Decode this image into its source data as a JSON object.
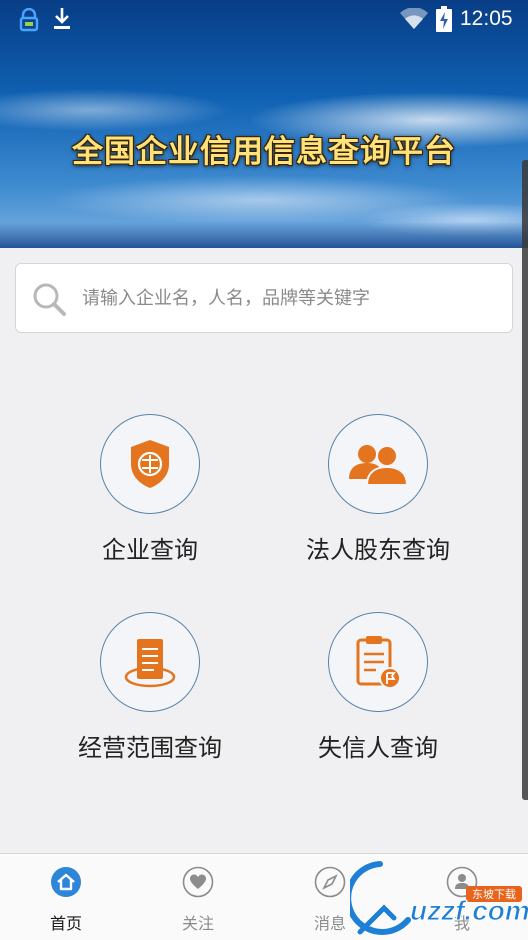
{
  "status_bar": {
    "time": "12:05",
    "icons": [
      "lock-icon",
      "download-icon",
      "wifi-icon",
      "battery-charging-icon"
    ]
  },
  "banner": {
    "title": "全国企业信用信息查询平台"
  },
  "search": {
    "placeholder": "请输入企业名，人名，品牌等关键字",
    "value": "",
    "icon": "search-icon"
  },
  "grid": [
    {
      "label": "企业查询",
      "icon": "shield-badge-icon"
    },
    {
      "label": "法人股东查询",
      "icon": "people-icon"
    },
    {
      "label": "经营范围查询",
      "icon": "document-stack-icon"
    },
    {
      "label": "失信人查询",
      "icon": "clipboard-flag-icon"
    }
  ],
  "bottom_nav": [
    {
      "label": "首页",
      "icon": "home-icon",
      "active": true
    },
    {
      "label": "关注",
      "icon": "heart-icon",
      "active": false
    },
    {
      "label": "消息",
      "icon": "compass-icon",
      "active": false
    },
    {
      "label": "我",
      "icon": "user-icon",
      "active": false
    }
  ],
  "watermark": {
    "text": "uzzf.com",
    "tag": "东坡下载"
  },
  "colors": {
    "accent_orange": "#e4741d",
    "nav_active_blue": "#2d86d8",
    "circle_border": "#5a82a8",
    "banner_title": "#ffe27a"
  }
}
